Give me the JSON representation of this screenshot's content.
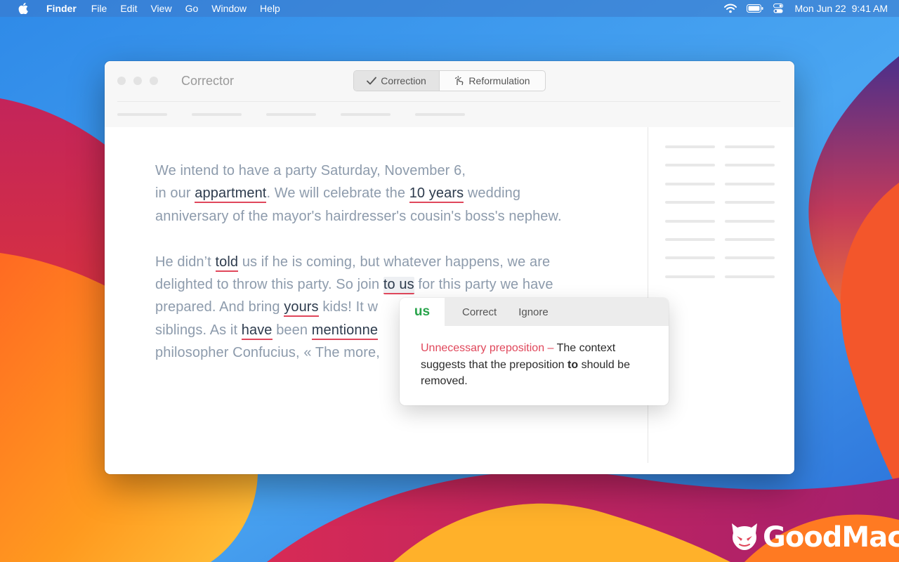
{
  "menubar": {
    "app_name": "Finder",
    "items": [
      "File",
      "Edit",
      "View",
      "Go",
      "Window",
      "Help"
    ],
    "date": "Mon Jun 22",
    "time": "9:41 AM"
  },
  "window": {
    "title": "Corrector",
    "tabs": [
      {
        "label": "Correction",
        "icon": "checkmark-icon",
        "active": true
      },
      {
        "label": "Reformulation",
        "icon": "rewrite-hand-icon",
        "active": false
      }
    ]
  },
  "document": {
    "paragraphs": [
      {
        "lines": [
          [
            {
              "t": "We intend to have a party Saturday, November 6,"
            }
          ],
          [
            {
              "t": "in our "
            },
            {
              "t": "appartment",
              "err": true
            },
            {
              "t": ".  We will celebrate the "
            },
            {
              "t": "10 years",
              "err": true
            },
            {
              "t": " wedding"
            }
          ],
          [
            {
              "t": "anniversary of the mayor's hairdresser's cousin's boss's nephew."
            }
          ]
        ]
      },
      {
        "lines": [
          [
            {
              "t": "He didn’t "
            },
            {
              "t": "told",
              "err": true
            },
            {
              "t": " us if he is coming, but whatever happens, we are"
            }
          ],
          [
            {
              "t": "delighted to throw this party. So join "
            },
            {
              "t": "to us",
              "err": true,
              "selected": true
            },
            {
              "t": " for this party we have"
            }
          ],
          [
            {
              "t": "prepared. And bring "
            },
            {
              "t": "yours",
              "err": true
            },
            {
              "t": " kids! It w"
            }
          ],
          [
            {
              "t": "siblings. As it "
            },
            {
              "t": "have",
              "err": true
            },
            {
              "t": " been "
            },
            {
              "t": "mentionne",
              "err": true
            }
          ],
          [
            {
              "t": "philosopher Confucius, « The more,"
            }
          ]
        ]
      }
    ]
  },
  "popover": {
    "suggestion": "us",
    "correct_label": "Correct",
    "ignore_label": "Ignore",
    "rule": "Unnecessary preposition –",
    "explanation_before": " The context suggests that the preposition ",
    "keyword": "to",
    "explanation_after": " should be removed."
  },
  "watermark": {
    "brand": "GoodMac"
  },
  "colors": {
    "error_underline": "#e0475b",
    "suggestion_green": "#27a34a",
    "body_text": "#8d9bac",
    "error_text": "#2d3b4d"
  }
}
